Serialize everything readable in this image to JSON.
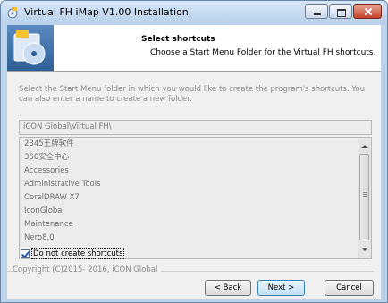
{
  "window": {
    "title": "Virtual FH iMap V1.00 Installation"
  },
  "header": {
    "title": "Select shortcuts",
    "subtitle": "Choose a Start Menu Folder for the Virtual FH shortcuts."
  },
  "main": {
    "description": "Select the Start Menu folder in which you would like to create the program's shortcuts. You can also enter a name to create a new folder.",
    "folder_value": "iCON Global\\Virtual FH\\",
    "folders": [
      "2345王牌软件",
      "360安全中心",
      "Accessories",
      "Administrative Tools",
      "CorelDRAW X7",
      "IconGlobal",
      "Maintenance",
      "Nero8.0"
    ],
    "no_shortcuts_label": "Do not create shortcuts",
    "no_shortcuts_checked": true
  },
  "footer": {
    "copyright": "Copyright (C)2015- 2016, iCON Global"
  },
  "buttons": {
    "back": "< Back",
    "next": "Next >",
    "cancel": "Cancel"
  },
  "colors": {
    "titlebar": "#b9d1ea",
    "close_button": "#c2402a",
    "next_button_border": "#3c7fb1"
  }
}
